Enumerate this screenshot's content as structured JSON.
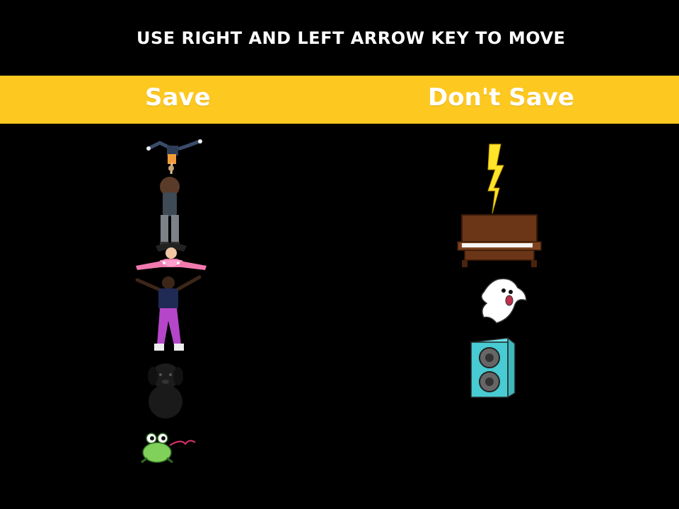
{
  "game": {
    "instructions": "USE RIGHT AND LEFT ARROW KEY TO MOVE",
    "columns": {
      "save_label": "Save",
      "dont_save_label": "Don't Save"
    },
    "colors": {
      "banner": "#FDC81F",
      "background": "#000000",
      "text": "#FFFFFF"
    },
    "save_stack": [
      "handstand-kid",
      "bending-woman",
      "ballerina-girl",
      "dancing-man",
      "black-puppy",
      "green-frog"
    ],
    "dont_save_stack": [
      "lightning-bolt",
      "upright-piano",
      "screaming-ghost",
      "speaker"
    ]
  }
}
